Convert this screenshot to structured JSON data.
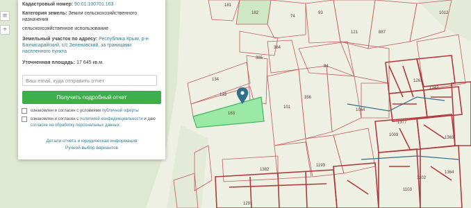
{
  "panel": {
    "cadastral_label": "Кадастровый номер:",
    "cadastral_value": "90:01:100701:163",
    "category_label": "Категория земель:",
    "category_value_1": "Земли сельскохозяйственного",
    "category_value_2": "назначения",
    "category_value_3": "сельскохозяйственное использование",
    "address_label": "Земельный участок по адресу:",
    "address_value_1": "Республика Крым, р-н",
    "address_value_2": "Бахчисарайский, с/с Зеленовский, за границами",
    "address_value_3": "населенного пункта",
    "area_label": "Уточненная площадь:",
    "area_value": "17 645 кв.м.",
    "email_placeholder": "Ваш email, куда отправить отчет",
    "report_button": "Получить подробный отчет",
    "consent_1_text": "ознакомлен и согласен с условиями",
    "consent_1_link": "публичной оферты",
    "consent_2_text_1": "ознакомлен и согласен с",
    "consent_2_link_1": "политикой конфиденциальности",
    "consent_2_text_2": "и даю",
    "consent_2_link_2": "согласие на обработку персональных данных",
    "details_link": "Детали отчета и юридическая информация",
    "manual_link": "Ручной выбор вариантов"
  },
  "tools": {
    "item1": "≡",
    "item2": "⌖"
  },
  "map": {
    "selected_parcel_label": "163",
    "parcel_labels": [
      "181",
      "182",
      "74",
      "93",
      "887",
      "1012",
      "121",
      "385",
      "384",
      "134",
      "133",
      "101",
      "356",
      "84",
      "1064",
      "1003",
      "1342",
      "1377",
      "1261",
      "1363",
      "1102",
      "1103",
      "1364",
      "1291",
      "1382",
      "1193"
    ],
    "colors": {
      "selected_fill": "#9be8a6",
      "selected_border": "#3cb85b",
      "parcel_line": "#c45a5a",
      "marker": "#2f6f8a",
      "background": "#eef0e4",
      "forest": "#dfe8d2"
    }
  }
}
